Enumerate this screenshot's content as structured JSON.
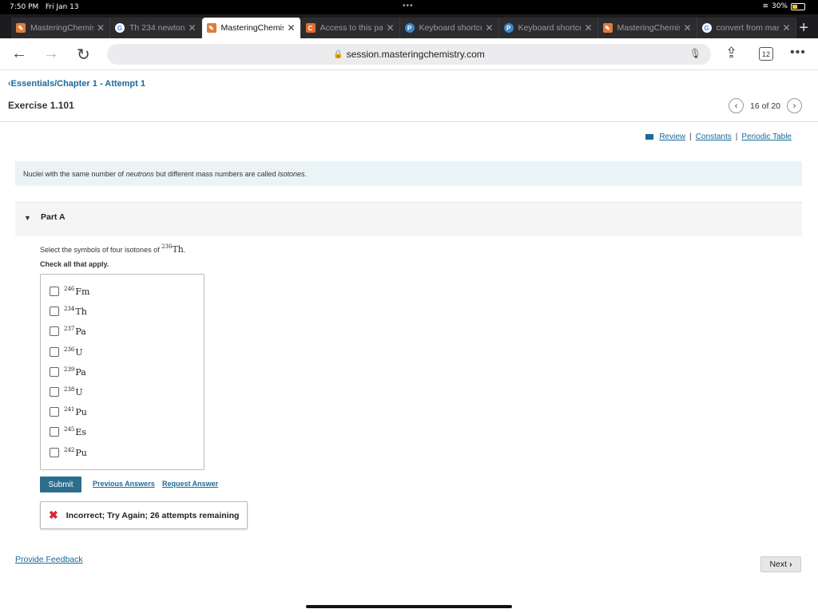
{
  "status": {
    "time": "7:50 PM",
    "date": "Fri Jan 13",
    "battery": "30%"
  },
  "tabs": [
    {
      "label": "MasteringChemistry",
      "favicon": "m",
      "active": false
    },
    {
      "label": "Th 234 newton",
      "favicon": "g",
      "active": false
    },
    {
      "label": "MasteringChemistry",
      "favicon": "m",
      "active": true
    },
    {
      "label": "Access to this page",
      "favicon": "c",
      "active": false
    },
    {
      "label": "Keyboard shortcuts",
      "favicon": "p",
      "active": false
    },
    {
      "label": "Keyboard shortcuts",
      "favicon": "p",
      "active": false
    },
    {
      "label": "MasteringChemistry",
      "favicon": "m",
      "active": false
    },
    {
      "label": "convert from mass",
      "favicon": "g",
      "active": false
    }
  ],
  "browser": {
    "url": "session.masteringchemistry.com",
    "tab_count": "12"
  },
  "page": {
    "breadcrumb": "Essentials/Chapter 1 - Attempt 1",
    "exercise_title": "Exercise 1.101",
    "pager": "16 of 20",
    "links": {
      "review": "Review",
      "constants": "Constants",
      "periodic": "Periodic Table"
    },
    "intro": {
      "before": "Nuclei with the same number of ",
      "em1": "neutrons",
      "middle": " but different mass numbers are called ",
      "em2": "isotones",
      "after": "."
    },
    "part_title": "Part A",
    "question": {
      "text": "Select the symbols of four isotones of ",
      "mass": "236",
      "symbol": "Th",
      "end": "."
    },
    "check_all": "Check all that apply.",
    "options": [
      {
        "mass": "246",
        "symbol": "Fm",
        "checked": false
      },
      {
        "mass": "234",
        "symbol": "Th",
        "checked": false
      },
      {
        "mass": "237",
        "symbol": "Pa",
        "checked": false
      },
      {
        "mass": "236",
        "symbol": "U",
        "checked": false
      },
      {
        "mass": "239",
        "symbol": "Pa",
        "checked": false
      },
      {
        "mass": "238",
        "symbol": "U",
        "checked": false
      },
      {
        "mass": "241",
        "symbol": "Pu",
        "checked": false
      },
      {
        "mass": "245",
        "symbol": "Es",
        "checked": false
      },
      {
        "mass": "242",
        "symbol": "Pu",
        "checked": false
      }
    ],
    "submit_label": "Submit",
    "previous_answers": "Previous Answers",
    "request_answer": "Request Answer",
    "feedback": "Incorrect; Try Again; 26 attempts remaining",
    "provide_feedback": "Provide Feedback",
    "next_label": "Next"
  },
  "colors": {
    "accent": "#196a9a",
    "submit": "#2c6e8e",
    "error": "#d9262b",
    "intro_bg": "#eaf4f6"
  }
}
